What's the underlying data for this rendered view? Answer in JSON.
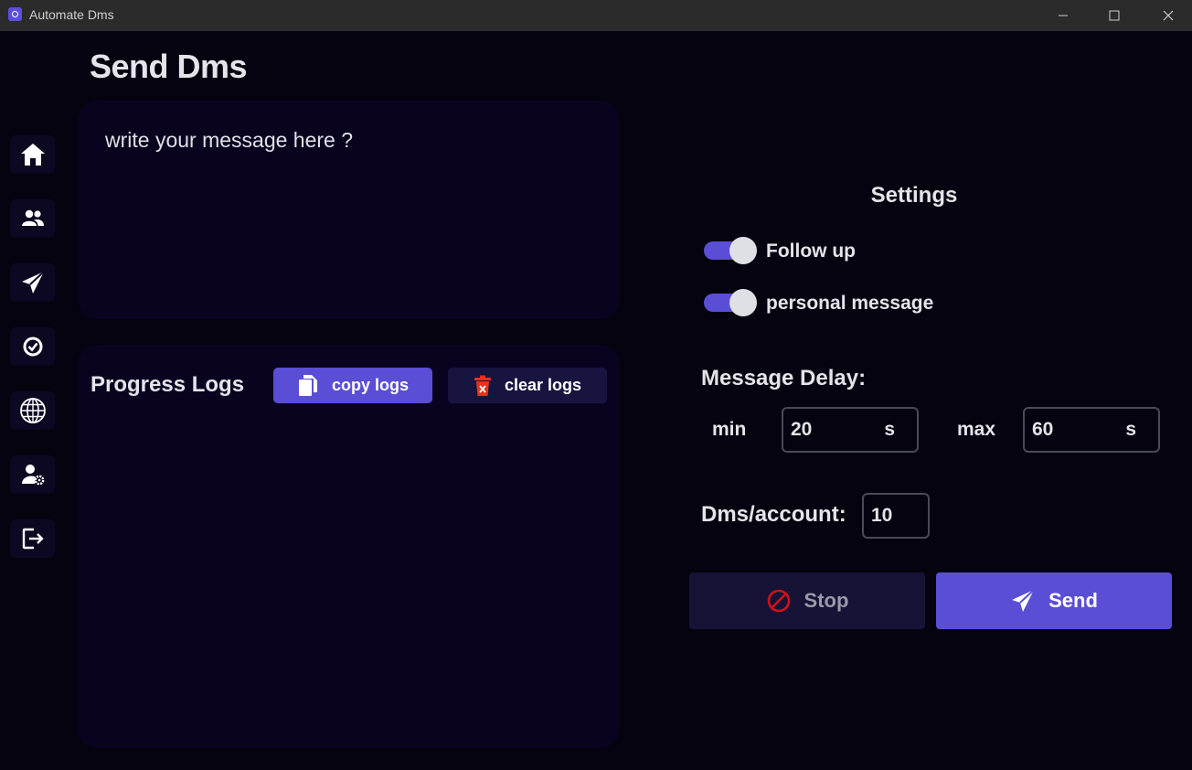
{
  "window": {
    "title": "Automate Dms",
    "controls": [
      "minimize-icon",
      "maximize-icon",
      "close-icon"
    ]
  },
  "page": {
    "title": "Send Dms"
  },
  "sidebar": {
    "items": [
      {
        "icon": "home-icon",
        "active": true
      },
      {
        "icon": "users-icon"
      },
      {
        "icon": "send-icon"
      },
      {
        "icon": "check-circle-icon"
      },
      {
        "icon": "globe-icon"
      },
      {
        "icon": "user-settings-icon"
      },
      {
        "icon": "logout-icon"
      }
    ]
  },
  "message": {
    "placeholder": "write your message here ?",
    "value": ""
  },
  "logs": {
    "title": "Progress Logs",
    "copy_label": "copy logs",
    "clear_label": "clear logs",
    "entries": []
  },
  "settings": {
    "title": "Settings",
    "follow_up": {
      "label": "Follow up",
      "enabled": true
    },
    "personal_message": {
      "label": "personal message",
      "enabled": true
    },
    "delay": {
      "title": "Message Delay:",
      "min_label": "min",
      "min_value": "20",
      "max_label": "max",
      "max_value": "60",
      "unit": "s"
    },
    "dms_per_account": {
      "label": "Dms/account:",
      "value": "10"
    }
  },
  "actions": {
    "stop_label": "Stop",
    "send_label": "Send"
  },
  "colors": {
    "accent": "#5b4ed6",
    "background": "#05030f",
    "panel": "#0a0320",
    "stop_icon": "#d0101a",
    "clear_icon": "#e8321b"
  }
}
